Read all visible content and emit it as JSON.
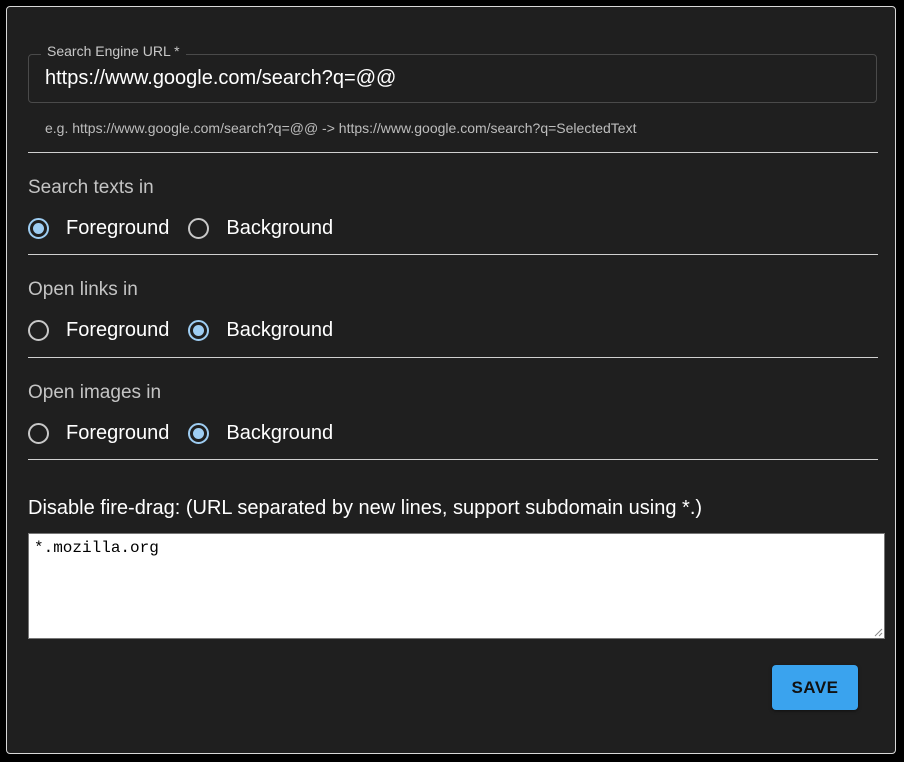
{
  "search_engine": {
    "label": "Search Engine URL *",
    "value": "https://www.google.com/search?q=@@",
    "helper": "e.g. https://www.google.com/search?q=@@ -> https://www.google.com/search?q=SelectedText"
  },
  "sections": [
    {
      "title": "Search texts in",
      "options": [
        {
          "label": "Foreground",
          "checked": true
        },
        {
          "label": "Background",
          "checked": false
        }
      ]
    },
    {
      "title": "Open links in",
      "options": [
        {
          "label": "Foreground",
          "checked": false
        },
        {
          "label": "Background",
          "checked": true
        }
      ]
    },
    {
      "title": "Open images in",
      "options": [
        {
          "label": "Foreground",
          "checked": false
        },
        {
          "label": "Background",
          "checked": true
        }
      ]
    }
  ],
  "disable_fire_drag": {
    "label": "Disable fire-drag: (URL separated by new lines, support subdomain using *.)",
    "value": "*.mozilla.org"
  },
  "save_label": "SAVE",
  "colors": {
    "panel_background": "#1f1f1f",
    "radio_accent": "#9ecdf2",
    "save_button": "#3aa3ee"
  }
}
